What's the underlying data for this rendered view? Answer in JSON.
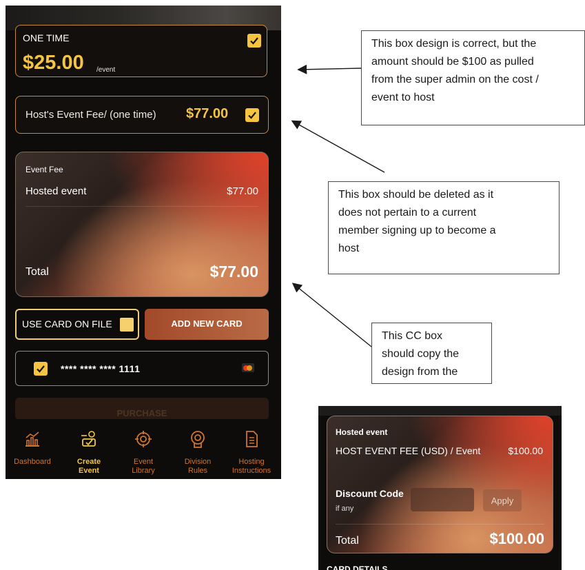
{
  "app": {
    "plan": {
      "title": "ONE TIME",
      "price": "$25.00",
      "unit": "/event",
      "checked": true
    },
    "host_fee": {
      "label": "Host's Event Fee/ (one time)",
      "amount": "$77.00",
      "checked": true
    },
    "summary": {
      "heading": "Event Fee",
      "item_label": "Hosted event",
      "item_value": "$77.00",
      "total_label": "Total",
      "total_value": "$77.00"
    },
    "payment": {
      "use_card_label": "USE CARD ON FILE",
      "add_card_label": "ADD NEW CARD",
      "saved_card_number": "**** **** **** 1111",
      "purchase_label": "PURCHASE"
    },
    "nav": {
      "items": [
        {
          "line1": "Dashboard",
          "line2": "",
          "icon": "dashboard-chart-icon",
          "active": false
        },
        {
          "line1": "Create",
          "line2": "Event",
          "icon": "create-event-icon",
          "active": true
        },
        {
          "line1": "Event",
          "line2": "Library",
          "icon": "target-icon",
          "active": false
        },
        {
          "line1": "Division",
          "line2": "Rules",
          "icon": "award-icon",
          "active": false
        },
        {
          "line1": "Hosting",
          "line2": "Instructions",
          "icon": "document-icon",
          "active": false
        }
      ]
    }
  },
  "annotations": {
    "note1": [
      "This box design is correct, but the",
      "amount should be $100 as pulled",
      "from the super admin on the cost /",
      "event to host"
    ],
    "note2": [
      "This box should be deleted as it",
      "does not pertain to a current",
      "member signing up to become a",
      "host"
    ],
    "note3": [
      "This CC box",
      "should copy the",
      "design from the"
    ]
  },
  "reference": {
    "heading": "Hosted event",
    "item_label": "HOST EVENT FEE (USD) / Event",
    "item_value": "$100.00",
    "discount_label": "Discount Code",
    "discount_sub": "if any",
    "apply_label": "Apply",
    "total_label": "Total",
    "total_value": "$100.00",
    "card_details_label": "CARD DETAILS"
  },
  "colors": {
    "accent_gold": "#f5c542",
    "nav_orange": "#d0752d",
    "border_gold": "#c58a3c"
  }
}
